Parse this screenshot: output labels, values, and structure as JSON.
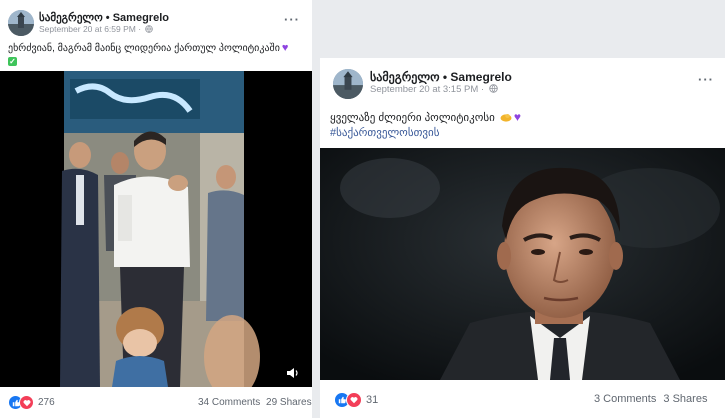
{
  "posts": [
    {
      "page_name": "სამეგრელო • Samegrelo",
      "timestamp": "September 20 at 6:59 PM",
      "text": "ეხრძვიან, მაგრამ მაინც ლიდერია ქართულ პოლიტიკაში",
      "reaction_count": "276",
      "comments": "34 Comments",
      "shares": "29 Shares",
      "media": "video"
    },
    {
      "page_name": "სამეგრელო • Samegrelo",
      "timestamp": "September 20 at 3:15 PM",
      "text": "ყველაზე ძლიერი პოლიტიკოსი",
      "hashtag": "#საქართველოსთვის",
      "reaction_count": "31",
      "comments": "3 Comments",
      "shares": "3 Shares",
      "media": "photo"
    }
  ],
  "icons": {
    "globe": "globe-icon",
    "more": "more-options-icon",
    "like": "like-reaction-icon",
    "love": "love-reaction-icon",
    "volume": "volume-icon",
    "heart": "purple-heart-emoji",
    "muscle": "flexed-biceps-emoji",
    "check": "check-mark-emoji"
  },
  "colors": {
    "link": "#385898",
    "like": "#1877f2",
    "love": "#f33e58",
    "heart": "#8e44e0"
  }
}
